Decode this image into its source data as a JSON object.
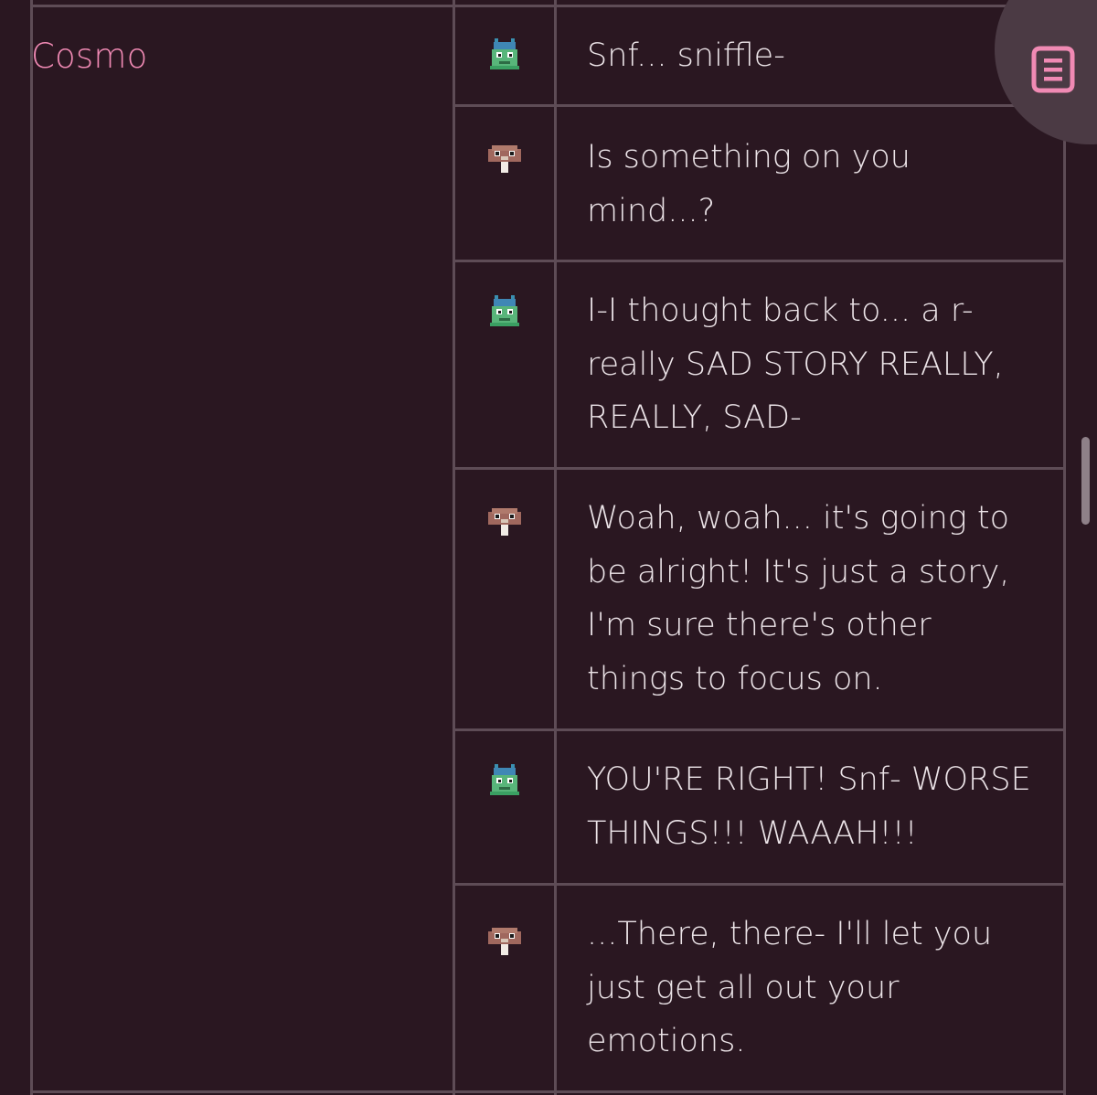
{
  "speaker_name": "Cosmo",
  "speaker_color": "#f08ab4",
  "text_color": "#ece4e8",
  "background": "#2a1721",
  "notes_button_icon": "notes-list-icon",
  "lines": [
    {
      "icon": "green-bug-sprite-icon",
      "text": "Snf... sniffle-"
    },
    {
      "icon": "brown-bird-sprite-icon",
      "text": "Is something on you\nmind...?"
    },
    {
      "icon": "green-bug-sprite-icon",
      "text": "I-I thought back to... a r-\nreally SAD STORY REALLY,\nREALLY, SAD-"
    },
    {
      "icon": "brown-bird-sprite-icon",
      "text": "Woah, woah... it's going to\nbe alright! It's just a story,\nI'm sure there's other\nthings to focus on."
    },
    {
      "icon": "green-bug-sprite-icon",
      "text": "YOU'RE RIGHT! Snf- WORSE\nTHINGS!!! WAAAH!!!"
    },
    {
      "icon": "brown-bird-sprite-icon",
      "text": "...There, there- I'll let you\njust get all out your\nemotions."
    }
  ]
}
